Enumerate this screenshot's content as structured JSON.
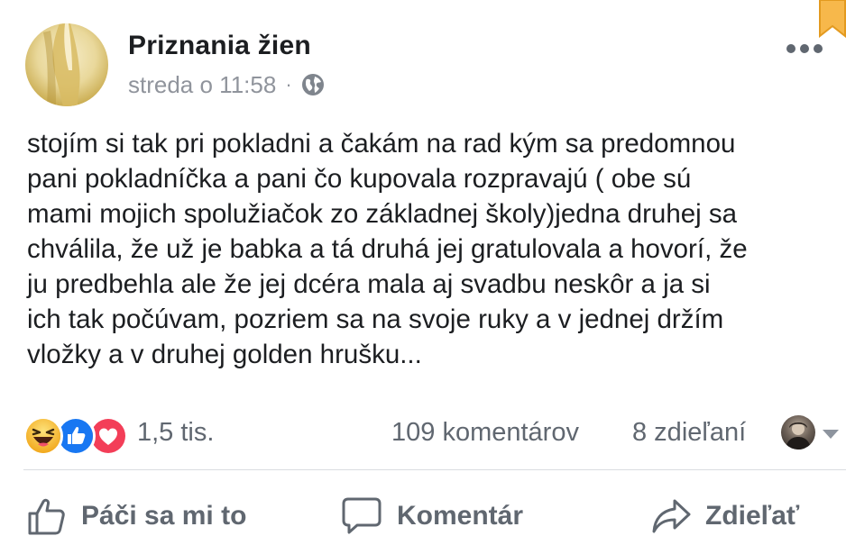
{
  "post": {
    "page_name": "Priznania žien",
    "timestamp": "streda o 11:58",
    "separator": "·",
    "privacy_icon": "globe-icon",
    "text": "stojím si tak pri pokladni a čakám na rad kým sa predomnou\npani pokladníčka a pani čo kupovala rozpravajú ( obe sú\nmami mojich spolužiačok zo základnej školy)jedna druhej sa\nchválila, že už je babka a tá druhá jej gratulovala a hovorí, že\nju predbehla ale že jej dcéra mala aj svadbu neskôr a ja si\nich tak počúvam, pozriem sa na svoje ruky a v jednej držím\nvložky a v druhej golden hrušku..."
  },
  "stats": {
    "reactions": [
      "haha",
      "like",
      "love"
    ],
    "reaction_count": "1,5 tis.",
    "comments": "109 komentárov",
    "shares": "8 zdieľaní"
  },
  "actions": {
    "like": "Páči sa mi to",
    "comment": "Komentár",
    "share": "Zdieľať"
  },
  "colors": {
    "like_blue": "#1877f2",
    "love_red": "#f33e58",
    "haha_yellow": "#f7b125",
    "bookmark_orange": "#f5a623",
    "secondary_text": "#90949c"
  }
}
